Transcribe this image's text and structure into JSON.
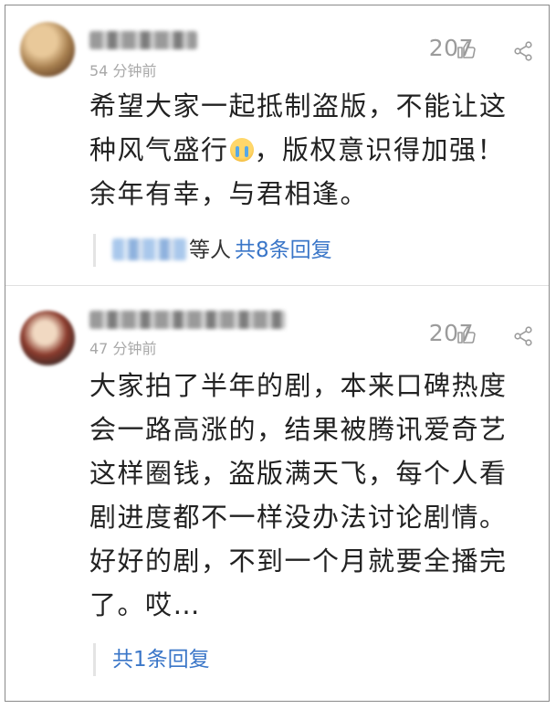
{
  "comments": [
    {
      "time": "54 分钟前",
      "likes": "207",
      "text_lines": [
        "希望大家一起抵制盗版，不能让这",
        "种风气盛行",
        "，版权意识得加强！",
        "余年有幸，与君相逢。"
      ],
      "reply_others": "等人",
      "reply_link": "共8条回复"
    },
    {
      "time": "47 分钟前",
      "likes": "207",
      "text_lines": [
        "大家拍了半年的剧，本来口碑热度",
        "会一路高涨的，结果被腾讯爱奇艺",
        "这样圈钱，盗版满天飞，每个人看",
        "剧进度都不一样没办法讨论剧情。",
        "好好的剧，不到一个月就要全播完",
        "了。哎…"
      ],
      "reply_link": "共1条回复"
    }
  ],
  "icons": {
    "like": "thumbs-up-icon",
    "share": "share-icon",
    "emoji": "crying-face-emoji"
  },
  "colors": {
    "link": "#3a76c8",
    "meta": "#a8a8a8",
    "text": "#222222"
  }
}
